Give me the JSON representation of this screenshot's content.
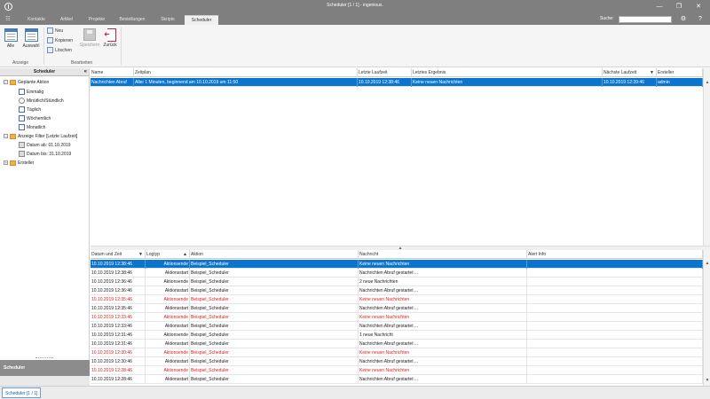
{
  "window": {
    "title": "Scheduler [1 / 1] - ingenious.",
    "controls": [
      "—",
      "❐",
      "✕"
    ]
  },
  "ribbon_tabs": [
    "Kontakte",
    "Artikel",
    "Projekte",
    "Bestellungen",
    "Skripte",
    "Scheduler"
  ],
  "active_tab": "Scheduler",
  "search": {
    "label": "Suche:",
    "value": ""
  },
  "ribbon": {
    "anzeige": {
      "label": "Anzeige",
      "alle": "Alle",
      "auswahl": "Auswahl"
    },
    "bearbeiten": {
      "label": "Bearbeiten",
      "neu": "Neu",
      "kopieren": "Kopieren",
      "loeschen": "Löschen",
      "speichern": "Speichern",
      "zurueck": "Zurück"
    }
  },
  "left_panel": {
    "title": "Scheduler",
    "collapse": "«",
    "tree": {
      "geplante_aktion": "Geplante Aktion",
      "einmalig": "Einmalig",
      "minuetlich": "Minütlich/Stündlich",
      "taeglich": "Täglich",
      "woechentlich": "Wöchentlich",
      "monatlich": "Monatlich",
      "anzeige_filter": "Anzeige Filter [Letzte Laufzeit]",
      "datum_ab": "Datum ab: 01.10.2019",
      "datum_bis": "Datum bis: 31.10.2019",
      "ersteller": "Ersteller"
    },
    "bottom_label": "Scheduler"
  },
  "top_grid": {
    "headers": [
      "Name",
      "Zeitplan",
      "Letzte Laufzeit",
      "Letztes Ergebnis",
      "Nächste Laufzeit",
      "Ersteller"
    ],
    "sort_indicator": "▼",
    "rows": [
      [
        "Nachrichten Abruf",
        "Aller 1 Minuten, beginnend am 10.10.2019 um 11:50",
        "10.10.2019 12:38:46",
        "Keine neuen Nachrichten",
        "10.10.2019 12:39:46",
        "admin"
      ]
    ]
  },
  "splitter_glyph": "▲",
  "log_grid": {
    "headers": [
      "Datum und Zeit",
      "Logtyp",
      "Aktion",
      "Nachricht",
      "Alert Info"
    ],
    "sort_down": "▼",
    "sort_up": "▲",
    "rows": [
      {
        "t": "10.10.2019 12:38:46",
        "type": "Aktionsende",
        "action": "Beispiel_Scheduler",
        "msg": "Keine neuen Nachrichten",
        "alert": "",
        "err": false,
        "sel": true
      },
      {
        "t": "10.10.2019 12:38:46",
        "type": "Aktionsstart",
        "action": "Beispiel_Scheduler",
        "msg": "Nachrichten Abruf gestartet ...",
        "alert": "",
        "err": false,
        "sel": false
      },
      {
        "t": "10.10.2019 12:36:46",
        "type": "Aktionsende",
        "action": "Beispiel_Scheduler",
        "msg": "2 neue Nachrichten",
        "alert": "",
        "err": false,
        "sel": false
      },
      {
        "t": "10.10.2019 12:36:46",
        "type": "Aktionsstart",
        "action": "Beispiel_Scheduler",
        "msg": "Nachrichten Abruf gestartet ...",
        "alert": "",
        "err": false,
        "sel": false
      },
      {
        "t": "10.10.2019 12:35:46",
        "type": "Aktionsende",
        "action": "Beispiel_Scheduler",
        "msg": "Keine neuen Nachrichten",
        "alert": "",
        "err": true,
        "sel": false
      },
      {
        "t": "10.10.2019 12:35:46",
        "type": "Aktionsstart",
        "action": "Beispiel_Scheduler",
        "msg": "Nachrichten Abruf gestartet ...",
        "alert": "",
        "err": false,
        "sel": false
      },
      {
        "t": "10.10.2019 12:33:46",
        "type": "Aktionsende",
        "action": "Beispiel_Scheduler",
        "msg": "Keine neuen Nachrichten",
        "alert": "",
        "err": true,
        "sel": false
      },
      {
        "t": "10.10.2019 12:33:46",
        "type": "Aktionsstart",
        "action": "Beispiel_Scheduler",
        "msg": "Nachrichten Abruf gestartet ...",
        "alert": "",
        "err": false,
        "sel": false
      },
      {
        "t": "10.10.2019 12:31:46",
        "type": "Aktionsende",
        "action": "Beispiel_Scheduler",
        "msg": "1 neue Nachricht",
        "alert": "",
        "err": false,
        "sel": false
      },
      {
        "t": "10.10.2019 12:31:46",
        "type": "Aktionsstart",
        "action": "Beispiel_Scheduler",
        "msg": "Nachrichten Abruf gestartet ...",
        "alert": "",
        "err": false,
        "sel": false
      },
      {
        "t": "10.10.2019 12:30:46",
        "type": "Aktionsende",
        "action": "Beispiel_Scheduler",
        "msg": "Keine neuen Nachrichten",
        "alert": "",
        "err": true,
        "sel": false
      },
      {
        "t": "10.10.2019 12:30:46",
        "type": "Aktionsstart",
        "action": "Beispiel_Scheduler",
        "msg": "Nachrichten Abruf gestartet ...",
        "alert": "",
        "err": false,
        "sel": false
      },
      {
        "t": "10.10.2019 12:28:46",
        "type": "Aktionsende",
        "action": "Beispiel_Scheduler",
        "msg": "Keine neuen Nachrichten",
        "alert": "",
        "err": true,
        "sel": false
      },
      {
        "t": "10.10.2019 12:28:46",
        "type": "Aktionsstart",
        "action": "Beispiel_Scheduler",
        "msg": "Nachrichten Abruf gestartet ...",
        "alert": "",
        "err": false,
        "sel": false
      }
    ]
  },
  "statusbar": {
    "tab": "Scheduler [1 / 1]"
  },
  "colors": {
    "selection": "#0a74cf",
    "error_text": "#e02020",
    "titlebar": "#7f7f7f"
  }
}
